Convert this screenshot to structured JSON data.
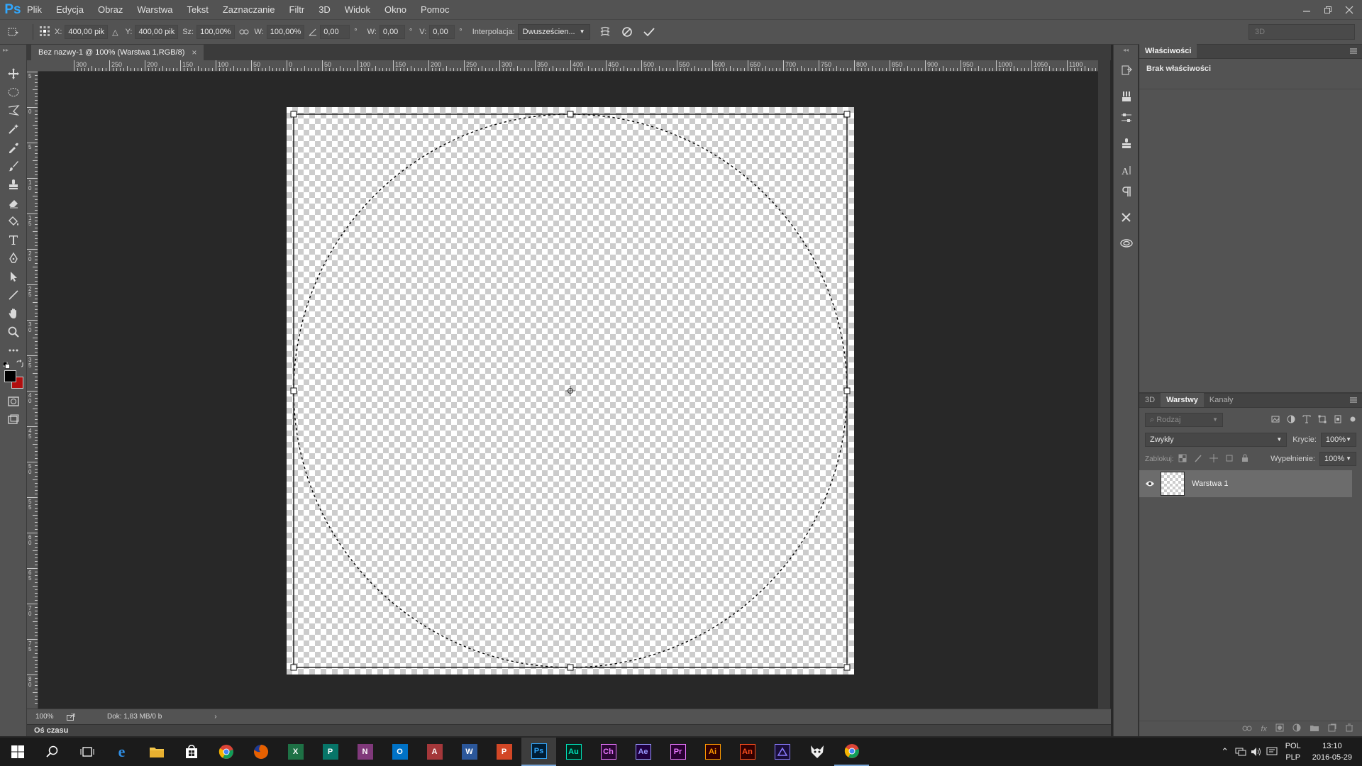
{
  "app": {
    "logo": "Ps",
    "menus": [
      "Plik",
      "Edycja",
      "Obraz",
      "Warstwa",
      "Tekst",
      "Zaznaczanie",
      "Filtr",
      "3D",
      "Widok",
      "Okno",
      "Pomoc"
    ]
  },
  "options": {
    "x_label": "X:",
    "x_value": "400,00 pik",
    "y_label": "Y:",
    "y_value": "400,00 pik",
    "w_label": "Sz:",
    "w_value": "100,00%",
    "h_label": "W:",
    "h_value": "100,00%",
    "angle_value": "0,00",
    "hskew_label": "W:",
    "hskew_value": "0,00",
    "vskew_label": "V:",
    "vskew_value": "0,00",
    "interp_label": "Interpolacja:",
    "interp_value": "Dwusześcien...",
    "workspace": "3D"
  },
  "document": {
    "tab_title": "Bez nazwy-1 @ 100% (Warstwa 1,RGB/8)",
    "ruler_top_labels": [
      "300",
      "250",
      "200",
      "150",
      "100",
      "50",
      "0",
      "50",
      "100",
      "150",
      "200",
      "250",
      "300",
      "350",
      "400",
      "450",
      "500",
      "550",
      "600",
      "650",
      "700",
      "750",
      "800",
      "850",
      "900",
      "950",
      "1000",
      "1050",
      "1100"
    ],
    "ruler_left_labels": [
      "5",
      "0",
      "5",
      "1 0",
      "1 5",
      "2 0",
      "2 5",
      "3 0",
      "3 5",
      "4 0",
      "4 5",
      "5 0",
      "5 5",
      "6 0",
      "6 5",
      "7 0",
      "7 5",
      "8 0"
    ]
  },
  "status": {
    "zoom": "100%",
    "doc_size": "Dok: 1,83 MB/0 b",
    "timeline": "Oś czasu"
  },
  "properties": {
    "tab": "Właściwości",
    "empty_text": "Brak właściwości"
  },
  "layers": {
    "tabs": [
      "3D",
      "Warstwy",
      "Kanały"
    ],
    "active_tab": "Warstwy",
    "filter_placeholder": "Rodzaj",
    "blend_mode": "Zwykły",
    "opacity_label": "Krycie:",
    "opacity_value": "100%",
    "lock_label": "Zablokuj:",
    "fill_label": "Wypełnienie:",
    "fill_value": "100%",
    "items": [
      {
        "name": "Warstwa 1"
      }
    ]
  },
  "taskbar": {
    "apps": [
      {
        "name": "excel",
        "label": "X",
        "color": "#1e7145"
      },
      {
        "name": "publisher",
        "label": "P",
        "color": "#077568"
      },
      {
        "name": "onenote",
        "label": "N",
        "color": "#80397b"
      },
      {
        "name": "outlook",
        "label": "O",
        "color": "#0072c6"
      },
      {
        "name": "access",
        "label": "A",
        "color": "#a4373a"
      },
      {
        "name": "word",
        "label": "W",
        "color": "#2b579a"
      },
      {
        "name": "powerpoint",
        "label": "P",
        "color": "#d24726"
      },
      {
        "name": "photoshop",
        "label": "Ps",
        "color": "#31a8ff",
        "bg": "#001e36"
      },
      {
        "name": "audition",
        "label": "Au",
        "color": "#00e4bb",
        "bg": "#00281e"
      },
      {
        "name": "character-animator",
        "label": "Ch",
        "color": "#ea77ff",
        "bg": "#2a0633"
      },
      {
        "name": "after-effects",
        "label": "Ae",
        "color": "#9999ff",
        "bg": "#1f0040"
      },
      {
        "name": "premiere",
        "label": "Pr",
        "color": "#ea77ff",
        "bg": "#2a0033"
      },
      {
        "name": "illustrator",
        "label": "Ai",
        "color": "#ff9a00",
        "bg": "#330000"
      },
      {
        "name": "animate",
        "label": "An",
        "color": "#ff4f1e",
        "bg": "#330000"
      }
    ],
    "lang_1": "POL",
    "lang_2": "PLP",
    "time": "13:10",
    "date": "2016-05-29"
  }
}
